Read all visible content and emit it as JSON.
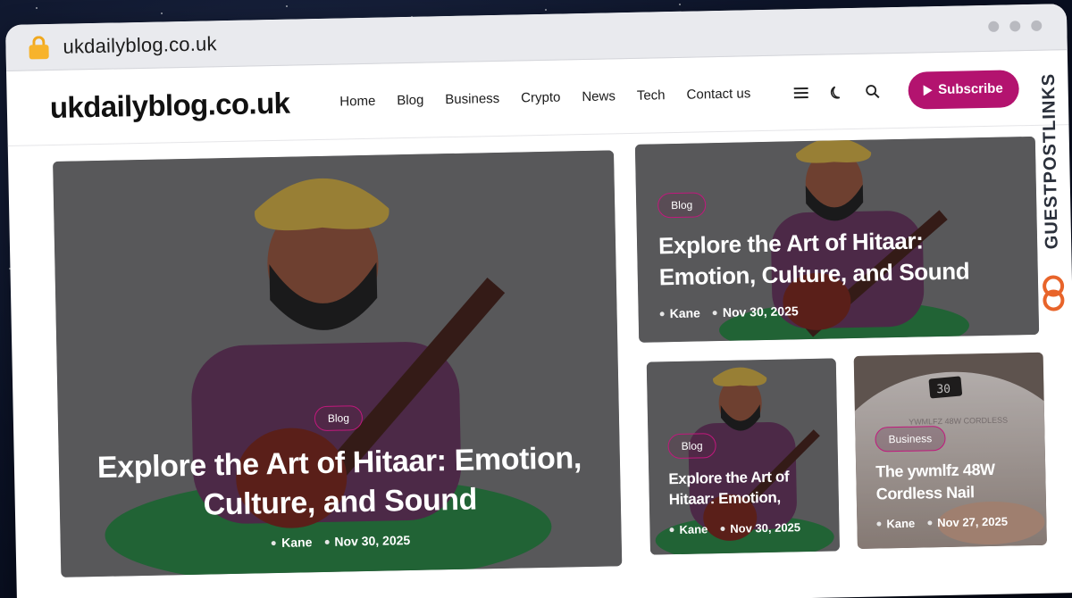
{
  "browser": {
    "url": "ukdailyblog.co.uk"
  },
  "site": {
    "logo": "ukdailyblog.co.uk",
    "nav": [
      "Home",
      "Blog",
      "Business",
      "Crypto",
      "News",
      "Tech",
      "Contact us"
    ],
    "subscribe_label": "Subscribe",
    "icons": [
      "menu-icon",
      "moon-icon",
      "search-icon",
      "play-icon"
    ]
  },
  "posts": {
    "featured": {
      "category": "Blog",
      "title": "Explore the Art of Hitaar: Emotion, Culture, and Sound",
      "author": "Kane",
      "date": "Nov 30, 2025"
    },
    "top_right": {
      "category": "Blog",
      "title": "Explore the Art of Hitaar: Emotion, Culture, and Sound",
      "author": "Kane",
      "date": "Nov 30, 2025"
    },
    "bottom_left": {
      "category": "Blog",
      "title": "Explore the Art of Hitaar: Emotion,",
      "author": "Kane",
      "date": "Nov 30, 2025"
    },
    "bottom_right": {
      "category": "Business",
      "title": "The ywmlfz 48W Cordless Nail",
      "author": "Kane",
      "date": "Nov 27, 2025",
      "device_display": "30",
      "device_text": "YWMLFZ 48W CORDLESS"
    }
  },
  "watermark": {
    "text": "GUESTPOSTLINKS"
  },
  "colors": {
    "accent": "#b3136f",
    "pill_border": "#c2187d",
    "lock": "#f7b32b",
    "background": "#0b1226"
  }
}
